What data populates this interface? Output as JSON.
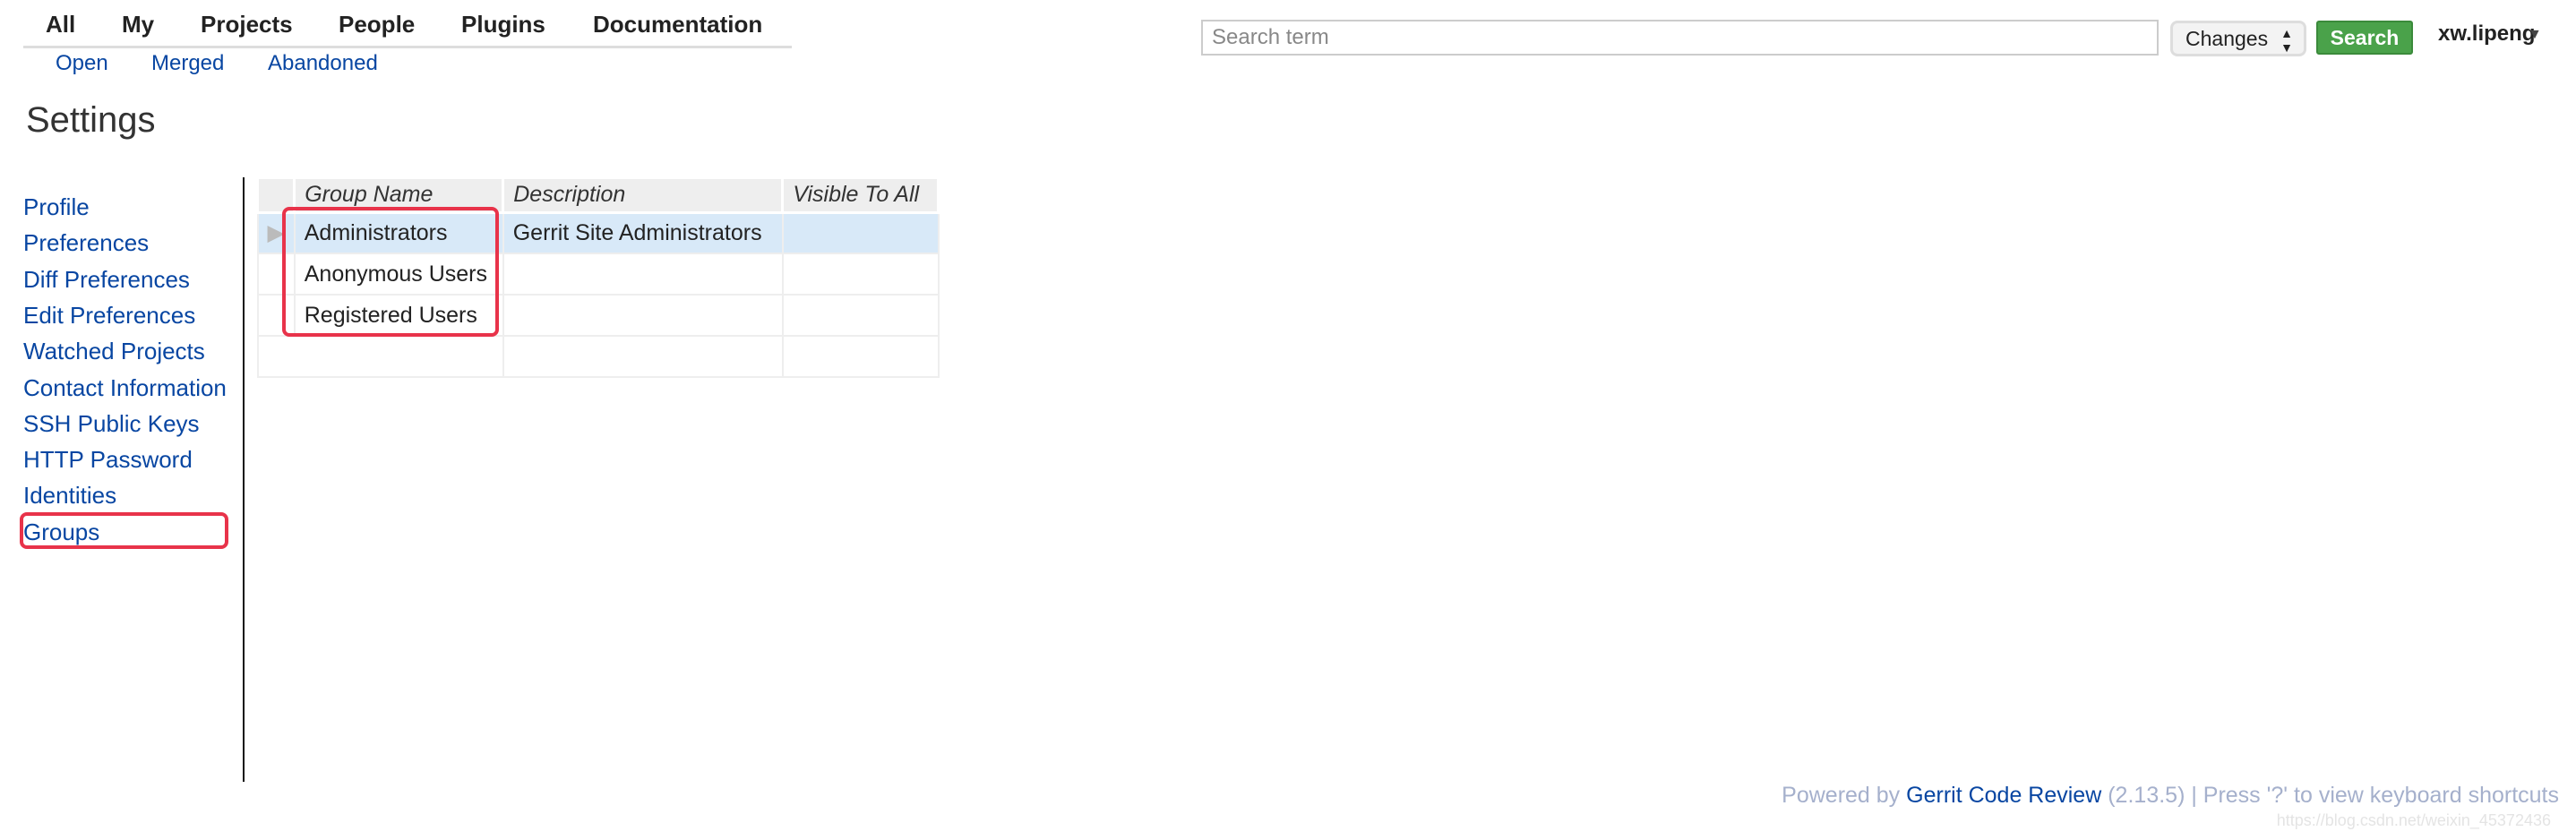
{
  "top_nav": {
    "items": [
      "All",
      "My",
      "Projects",
      "People",
      "Plugins",
      "Documentation"
    ],
    "sub_items": [
      "Open",
      "Merged",
      "Abandoned"
    ]
  },
  "header": {
    "search_placeholder": "Search term",
    "scope": "Changes",
    "search_label": "Search",
    "user": "xw.lipeng"
  },
  "page_title": "Settings",
  "sidebar": {
    "items": [
      "Profile",
      "Preferences",
      "Diff Preferences",
      "Edit Preferences",
      "Watched Projects",
      "Contact Information",
      "SSH Public Keys",
      "HTTP Password",
      "Identities",
      "Groups"
    ],
    "active": "Groups"
  },
  "groups_table": {
    "columns": [
      "Group Name",
      "Description",
      "Visible To All"
    ],
    "rows": [
      {
        "name": "Administrators",
        "description": "Gerrit Site Administrators",
        "visible": ""
      },
      {
        "name": "Anonymous Users",
        "description": "",
        "visible": ""
      },
      {
        "name": "Registered Users",
        "description": "",
        "visible": ""
      }
    ]
  },
  "footer": {
    "prefix": "Powered by",
    "link": "Gerrit Code Review",
    "suffix": "(2.13.5) | Press '?' to view keyboard shortcuts"
  },
  "watermark": "https://blog.csdn.net/weixin_45372436",
  "colors": {
    "link": "#0846a2",
    "highlight": "#e8334a",
    "button": "#4aa24a",
    "selected_row": "#d8e9f8"
  }
}
